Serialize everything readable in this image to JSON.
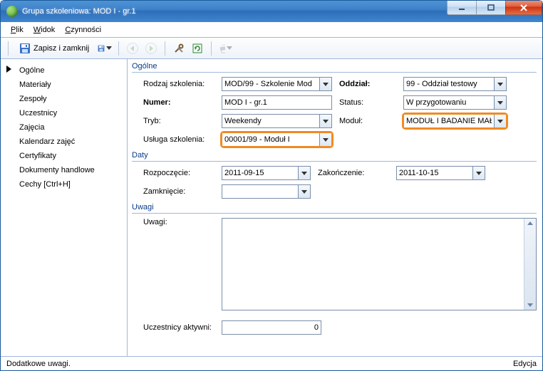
{
  "window": {
    "title": "Grupa szkoleniowa: MOD I - gr.1"
  },
  "menu": {
    "file": "Plik",
    "view": "Widok",
    "actions": "Czynności"
  },
  "toolbar": {
    "save_close_label": "Zapisz i zamknij"
  },
  "sidebar": {
    "items": [
      "Ogólne",
      "Materiały",
      "Zespoły",
      "Uczestnicy",
      "Zajęcia",
      "Kalendarz zajęć",
      "Certyfikaty",
      "Dokumenty handlowe",
      "Cechy [Ctrl+H]"
    ]
  },
  "sections": {
    "general": {
      "legend": "Ogólne",
      "rodzaj_label": "Rodzaj szkolenia:",
      "rodzaj_value": "MOD/99 - Szkolenie Mod",
      "oddzial_label": "Oddział:",
      "oddzial_value": "99 - Oddział testowy",
      "numer_label": "Numer:",
      "numer_value": "MOD I - gr.1",
      "status_label": "Status:",
      "status_value": "W przygotowaniu",
      "tryb_label": "Tryb:",
      "tryb_value": "Weekendy",
      "modul_label": "Moduł:",
      "modul_value": "MODUŁ I BADANIE MAŁ",
      "usluga_label": "Usługa szkolenia:",
      "usluga_value": "00001/99 - Moduł I"
    },
    "dates": {
      "legend": "Daty",
      "start_label": "Rozpoczęcie:",
      "start_value": "2011-09-15",
      "end_label": "Zakończenie:",
      "end_value": "2011-10-15",
      "close_label": "Zamknięcie:",
      "close_value": ""
    },
    "notes": {
      "legend": "Uwagi",
      "label": "Uwagi:",
      "value": ""
    },
    "active": {
      "label": "Uczestnicy aktywni:",
      "value": "0"
    }
  },
  "statusbar": {
    "left": "Dodatkowe uwagi.",
    "right": "Edycja"
  }
}
